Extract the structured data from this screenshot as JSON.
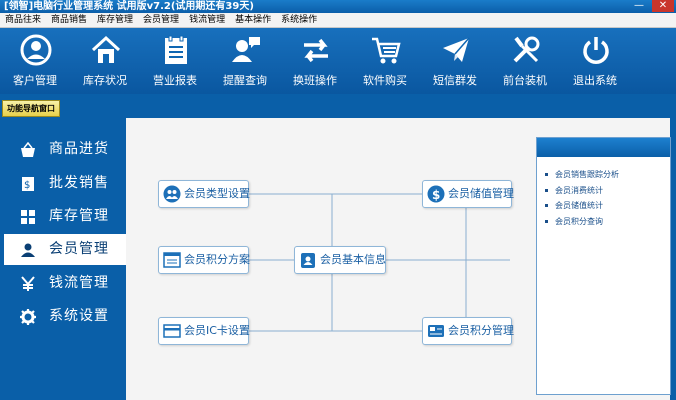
{
  "window": {
    "title": "[领智]电脑行业管理系统 试用版v7.2(试用期还有39天)"
  },
  "menu": [
    "商品往来",
    "商品销售",
    "库存管理",
    "会员管理",
    "钱流管理",
    "基本操作",
    "系统操作"
  ],
  "toolbar": [
    {
      "label": "客户管理",
      "icon": "user-circle-icon"
    },
    {
      "label": "库存状况",
      "icon": "house-icon"
    },
    {
      "label": "营业报表",
      "icon": "report-icon"
    },
    {
      "label": "提醒查询",
      "icon": "user-chat-icon"
    },
    {
      "label": "换班操作",
      "icon": "swap-arrows-icon"
    },
    {
      "label": "软件购买",
      "icon": "cart-icon"
    },
    {
      "label": "短信群发",
      "icon": "envelope-icon"
    },
    {
      "label": "前台装机",
      "icon": "tools-icon"
    },
    {
      "label": "退出系统",
      "icon": "power-icon"
    }
  ],
  "nav_tab": "功能导航窗口",
  "sidebar": [
    {
      "label": "商品进货",
      "icon": "basket-icon"
    },
    {
      "label": "批发销售",
      "icon": "document-icon"
    },
    {
      "label": "库存管理",
      "icon": "grid-icon"
    },
    {
      "label": "会员管理",
      "icon": "person-icon"
    },
    {
      "label": "钱流管理",
      "icon": "yen-icon"
    },
    {
      "label": "系统设置",
      "icon": "gear-icon"
    }
  ],
  "flow": {
    "center": "会员基本信息",
    "type_setting": "会员类型设置",
    "points_plan": "会员积分方案",
    "ic_card": "会员IC卡设置",
    "deposit": "会员储值管理",
    "points_manage": "会员积分管理"
  },
  "panel_links": [
    "会员销售跟踪分析",
    "会员消费统计",
    "会员储值统计",
    "会员积分查询"
  ],
  "colors": {
    "brand_blue": "#0a5fa8",
    "content_bg": "#f4f4f4",
    "close_red": "#c9352b"
  }
}
